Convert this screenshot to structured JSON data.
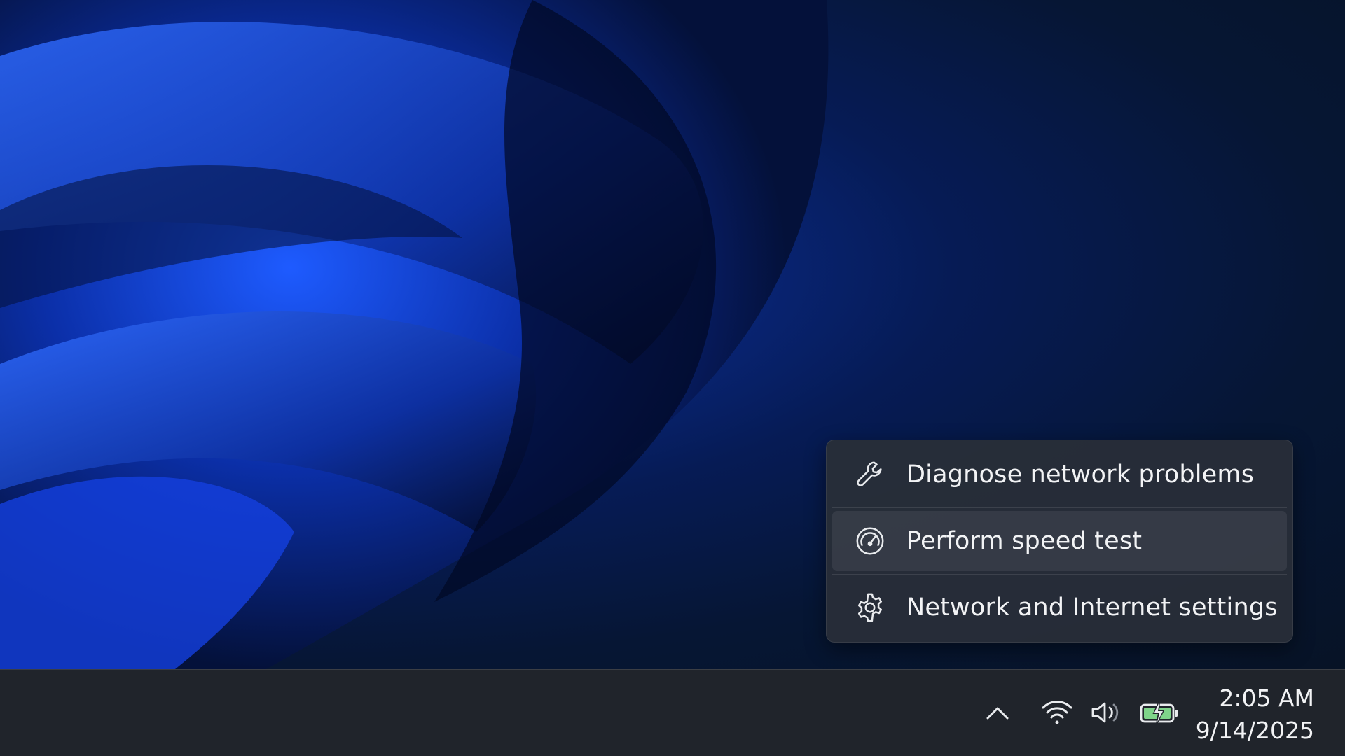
{
  "menu": {
    "items": [
      {
        "label": "Diagnose network problems",
        "icon": "wrench-icon"
      },
      {
        "label": "Perform speed test",
        "icon": "speedometer-icon"
      },
      {
        "label": "Network and Internet settings",
        "icon": "gear-icon"
      }
    ]
  },
  "tray": {
    "icons": [
      "chevron-up-icon",
      "wifi-icon",
      "volume-icon",
      "battery-charging-icon"
    ]
  },
  "clock": {
    "time": "2:05 AM",
    "date": "9/14/2025"
  },
  "colors": {
    "menu_bg": "#282e38",
    "taskbar_bg": "#20242b",
    "text": "#f2f3f5",
    "battery_fill": "#7fd48a",
    "wallpaper_accent": "#1a4dff"
  }
}
